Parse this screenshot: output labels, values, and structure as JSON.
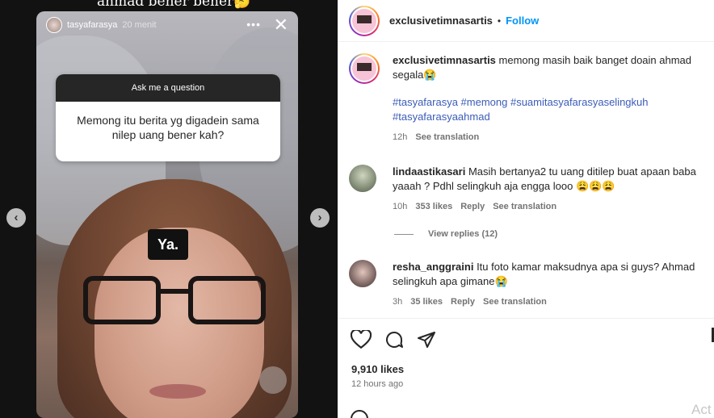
{
  "media": {
    "top_caption": "ahmad bener bener🤔",
    "story": {
      "username": "tasyafarasya",
      "time": "20 menit",
      "more_label": "•••",
      "close_label": "✕",
      "question_header": "Ask me a question",
      "question_text": "Memong itu berita yg digadein sama nilep uang bener kah?",
      "answer": "Ya."
    },
    "prev_arrow": "‹",
    "next_arrow": "›"
  },
  "post": {
    "header": {
      "username": "exclusivetimnasartis",
      "separator": "•",
      "follow_label": "Follow"
    },
    "caption": {
      "username": "exclusivetimnasartis",
      "text": "memong masih baik banget doain ahmad segala😭",
      "hashtags": "#tasyafarasya #memong #suamitasyafarasyaselingkuh #tasyafarasyaahmad",
      "time": "12h",
      "translation_label": "See translation"
    },
    "comments": [
      {
        "username": "lindaastikasari",
        "text": "Masih bertanya2 tu uang ditilep buat apaan baba yaaah ? Pdhl selingkuh aja engga looo 😩😩😩",
        "time": "10h",
        "likes": "353 likes",
        "reply_label": "Reply",
        "translation_label": "See translation",
        "view_replies": "View replies (12)"
      },
      {
        "username": "resha_anggraini",
        "text": "Itu foto kamar maksudnya apa si guys? Ahmad selingkuh apa gimane😭",
        "time": "3h",
        "likes": "35 likes",
        "reply_label": "Reply",
        "translation_label": "See translation"
      }
    ],
    "likes_count": "9,910 likes",
    "posted_ago": "12 hours ago"
  },
  "overlay": {
    "activate_text": "Act"
  },
  "icons": {
    "like": "heart-icon",
    "comment": "comment-icon",
    "share": "share-icon"
  }
}
